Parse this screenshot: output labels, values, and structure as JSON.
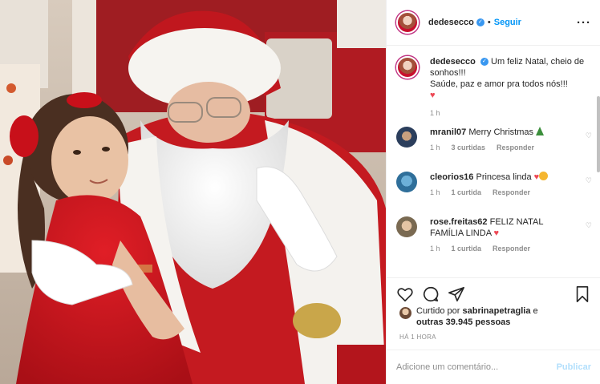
{
  "post": {
    "username": "dedesecco",
    "follow_label": "Seguir",
    "more_icon": "more-dots-icon",
    "verified_icon": "verified-badge-icon"
  },
  "caption": {
    "username": "dedesecco",
    "line1": "Um feliz Natal, cheio de sonhos!!!",
    "line2": "Saúde, paz e amor pra todos nós!!!",
    "time": "1 h"
  },
  "comments": [
    {
      "username": "mranil07",
      "text": "Merry Christmas",
      "emoji": "christmas-tree-icon",
      "time": "1 h",
      "likes": "3 curtidas",
      "reply": "Responder"
    },
    {
      "username": "cleorios16",
      "text": "Princesa linda",
      "emoji": "heart-clap-icons",
      "time": "1 h",
      "likes": "1 curtida",
      "reply": "Responder"
    },
    {
      "username": "rose.freitas62",
      "text": "FELIZ NATAL FAMÍLIA LINDA",
      "emoji": "red-heart-icon",
      "time": "1 h",
      "likes": "1 curtida",
      "reply": "Responder"
    }
  ],
  "likes": {
    "prefix": "Curtido por",
    "liker": "sabrinapetraglia",
    "connector": "e",
    "others": "outras 39.945 pessoas"
  },
  "posted_ago": "HÁ 1 HORA",
  "comment_box": {
    "placeholder": "Adicione um comentário...",
    "publish_label": "Publicar"
  },
  "colors": {
    "accent": "#0095f6",
    "publish_disabled": "#b2dffc",
    "heart": "#ed4956",
    "muted": "#8e8e8e"
  }
}
